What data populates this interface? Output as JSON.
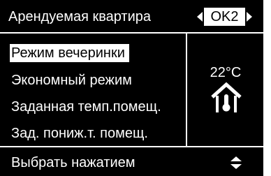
{
  "header": {
    "title": "Арендуемая квартира",
    "circuit": "OK2"
  },
  "menu": {
    "items": [
      {
        "label": "Режим вечеринки",
        "selected": true
      },
      {
        "label": "Экономный режим",
        "selected": false
      },
      {
        "label": "Заданная темп.помещ.",
        "selected": false
      },
      {
        "label": "Зад. пониж.т. помещ.",
        "selected": false
      }
    ]
  },
  "status": {
    "temperature": "22°C",
    "icon": "house-thermometer-icon"
  },
  "footer": {
    "label": "Выбрать нажатием",
    "icon": "up-down-arrows-icon"
  },
  "colors": {
    "background": "#000000",
    "foreground": "#ffffff"
  }
}
